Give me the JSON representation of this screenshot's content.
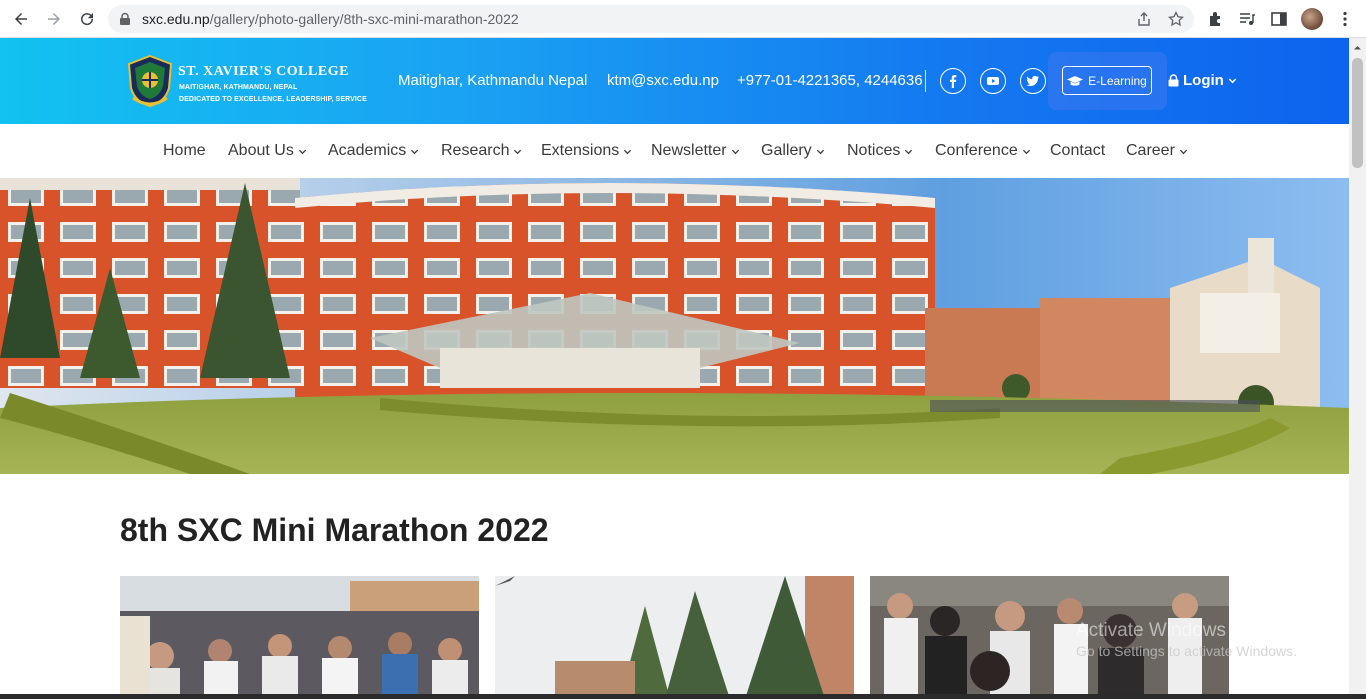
{
  "browser": {
    "url_host": "sxc.edu.np",
    "url_path": "/gallery/photo-gallery/8th-sxc-mini-marathon-2022"
  },
  "header": {
    "college_name": "ST. XAVIER'S COLLEGE",
    "college_address": "MAITIGHAR, KATHMANDU, NEPAL",
    "college_motto": "DEDICATED TO EXCELLENCE, LEADERSHIP, SERVICE",
    "location": "Maitighar, Kathmandu Nepal",
    "email": "ktm@sxc.edu.np",
    "phone": "+977-01-4221365, 4244636",
    "elearning_label": "E-Learning",
    "login_label": "Login"
  },
  "nav": {
    "items": [
      {
        "label": "Home"
      },
      {
        "label": "About Us"
      },
      {
        "label": "Academics"
      },
      {
        "label": "Research"
      },
      {
        "label": "Extensions"
      },
      {
        "label": "Newsletter"
      },
      {
        "label": "Gallery"
      },
      {
        "label": "Notices"
      },
      {
        "label": "Conference"
      },
      {
        "label": "Contact"
      },
      {
        "label": "Career"
      }
    ]
  },
  "page": {
    "title": "8th SXC Mini Marathon 2022"
  },
  "watermark": {
    "line1": "Activate Windows",
    "line2": "Go to Settings to activate Windows."
  },
  "colors": {
    "header_start": "#12c2f0",
    "header_end": "#0d63ee",
    "nav_text": "#3b3b3b"
  },
  "icons": {
    "social": [
      "facebook-icon",
      "youtube-icon",
      "twitter-icon"
    ]
  }
}
